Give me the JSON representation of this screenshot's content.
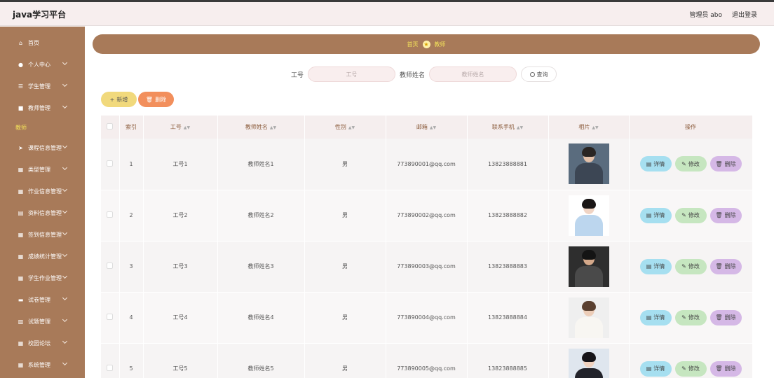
{
  "app": {
    "title": "java学习平台"
  },
  "top": {
    "user": "管理员 abo",
    "logout": "退出登录"
  },
  "sidebar": {
    "items": [
      {
        "label": "首页",
        "icon": "home-icon",
        "glyph": "⌂",
        "chevron": false
      },
      {
        "label": "个人中心",
        "icon": "user-icon",
        "glyph": "●",
        "chevron": true
      },
      {
        "label": "学生管理",
        "icon": "list-icon",
        "glyph": "☰",
        "chevron": true
      },
      {
        "label": "教师管理",
        "icon": "book-icon",
        "glyph": "■",
        "chevron": true
      }
    ],
    "group_label": "教师",
    "items2": [
      {
        "label": "课程信息管理",
        "icon": "send-icon",
        "glyph": "➤",
        "chevron": true
      },
      {
        "label": "类型管理",
        "icon": "grid-icon",
        "glyph": "▦",
        "chevron": true
      },
      {
        "label": "作业信息管理",
        "icon": "grid-icon",
        "glyph": "▦",
        "chevron": true
      },
      {
        "label": "资料信息管理",
        "icon": "archive-icon",
        "glyph": "▤",
        "chevron": true
      },
      {
        "label": "签到信息管理",
        "icon": "grid-icon",
        "glyph": "▦",
        "chevron": true
      },
      {
        "label": "成绩统计管理",
        "icon": "grid-icon",
        "glyph": "▦",
        "chevron": true
      },
      {
        "label": "学生作业管理",
        "icon": "grid-icon",
        "glyph": "▦",
        "chevron": true
      },
      {
        "label": "试卷管理",
        "icon": "file-icon",
        "glyph": "▬",
        "chevron": true
      },
      {
        "label": "试题管理",
        "icon": "chart-icon",
        "glyph": "▥",
        "chevron": true
      },
      {
        "label": "校园论坛",
        "icon": "grid-icon",
        "glyph": "▦",
        "chevron": true
      },
      {
        "label": "系统管理",
        "icon": "grid-icon",
        "glyph": "▦",
        "chevron": true
      }
    ]
  },
  "breadcrumb": {
    "home": "首页",
    "current": "教师"
  },
  "search": {
    "field1_label": "工号",
    "field1_placeholder": "工号",
    "field2_label": "教师姓名",
    "field2_placeholder": "教师姓名",
    "button": "查询"
  },
  "actions": {
    "add": "新增",
    "delete": "删除"
  },
  "table": {
    "headers": [
      "索引",
      "工号",
      "教师姓名",
      "性别",
      "邮箱",
      "联系手机",
      "相片",
      "操作"
    ],
    "rows": [
      {
        "index": "1",
        "id": "工号1",
        "name": "教师姓名1",
        "gender": "男",
        "email": "773890001@qq.com",
        "phone": "13823888881"
      },
      {
        "index": "2",
        "id": "工号2",
        "name": "教师姓名2",
        "gender": "男",
        "email": "773890002@qq.com",
        "phone": "13823888882"
      },
      {
        "index": "3",
        "id": "工号3",
        "name": "教师姓名3",
        "gender": "男",
        "email": "773890003@qq.com",
        "phone": "13823888883"
      },
      {
        "index": "4",
        "id": "工号4",
        "name": "教师姓名4",
        "gender": "男",
        "email": "773890004@qq.com",
        "phone": "13823888884"
      },
      {
        "index": "5",
        "id": "工号5",
        "name": "教师姓名5",
        "gender": "男",
        "email": "773890005@qq.com",
        "phone": "13823888885"
      }
    ],
    "op_detail": "详情",
    "op_edit": "修改",
    "op_delete": "删除"
  },
  "colors": {
    "sidebar": "#a87a59",
    "accent": "#f3e25a",
    "add": "#f1d97c",
    "delete": "#f28f5c"
  }
}
